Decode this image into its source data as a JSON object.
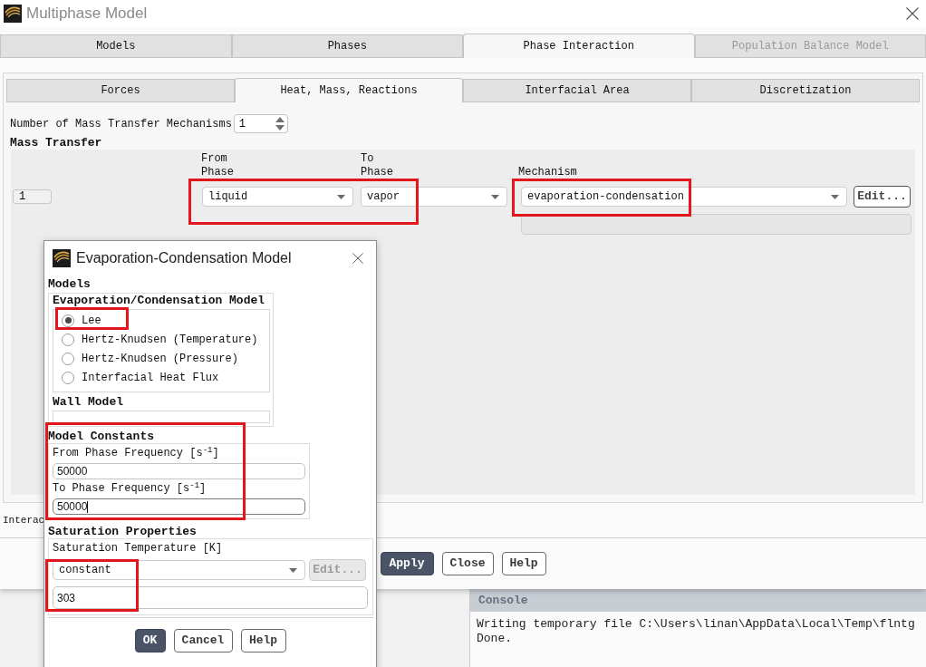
{
  "window": {
    "title": "Multiphase Model"
  },
  "tabs": [
    {
      "label": "Models",
      "selected": false,
      "disabled": false
    },
    {
      "label": "Phases",
      "selected": false,
      "disabled": false
    },
    {
      "label": "Phase Interaction",
      "selected": true,
      "disabled": false
    },
    {
      "label": "Population Balance Model",
      "selected": false,
      "disabled": true
    }
  ],
  "subtabs": [
    {
      "label": "Forces",
      "selected": false
    },
    {
      "label": "Heat, Mass, Reactions",
      "selected": true
    },
    {
      "label": "Interfacial Area",
      "selected": false
    },
    {
      "label": "Discretization",
      "selected": false
    }
  ],
  "mechanism_count": {
    "label": "Number of Mass Transfer Mechanisms",
    "value": "1"
  },
  "mass_transfer": {
    "title": "Mass Transfer",
    "columns": [
      "From Phase",
      "To Phase",
      "Mechanism"
    ],
    "rows": [
      {
        "index": "1",
        "from_phase": "liquid",
        "to_phase": "vapor",
        "phases_highlighted": true,
        "mechanism": "evaporation-condensation",
        "mechanism_highlighted": true,
        "edit_button": "Edit..."
      }
    ]
  },
  "bottom_label": "Interac",
  "buttons": [
    {
      "label": "Apply",
      "default": true
    },
    {
      "label": "Close",
      "default": false
    },
    {
      "label": "Help",
      "default": false
    }
  ],
  "console": {
    "title": "Console",
    "lines": [
      "Writing temporary file C:\\Users\\linan\\AppData\\Local\\Temp\\flntg",
      "Done."
    ]
  },
  "dialog": {
    "title": "Evaporation-Condensation Model",
    "models": {
      "title": "Models",
      "group_title": "Evaporation/Condensation Model",
      "options": [
        {
          "label": "Lee",
          "selected": true,
          "highlighted": true
        },
        {
          "label": "Hertz-Knudsen (Temperature)",
          "selected": false,
          "highlighted": false
        },
        {
          "label": "Hertz-Knudsen (Pressure)",
          "selected": false,
          "highlighted": false
        },
        {
          "label": "Interfacial Heat Flux",
          "selected": false,
          "highlighted": false
        }
      ],
      "wall_model_title": "Wall Model"
    },
    "model_constants": {
      "title": "Model Constants",
      "highlighted": true,
      "fields": [
        {
          "label": "From Phase Frequency [s$^{-1}$]",
          "value": "50000",
          "focused": false
        },
        {
          "label": "To Phase Frequency [s$^{-1}$]",
          "value": "50000",
          "focused": true
        }
      ]
    },
    "saturation": {
      "title": "Saturation Properties",
      "field_label": "Saturation Temperature [K]",
      "method": "constant",
      "value": "303",
      "highlighted": true,
      "edit_button": {
        "label": "Edit...",
        "disabled": true
      }
    },
    "buttons": [
      {
        "label": "OK",
        "default": true
      },
      {
        "label": "Cancel",
        "default": false
      },
      {
        "label": "Help",
        "default": false
      }
    ]
  }
}
